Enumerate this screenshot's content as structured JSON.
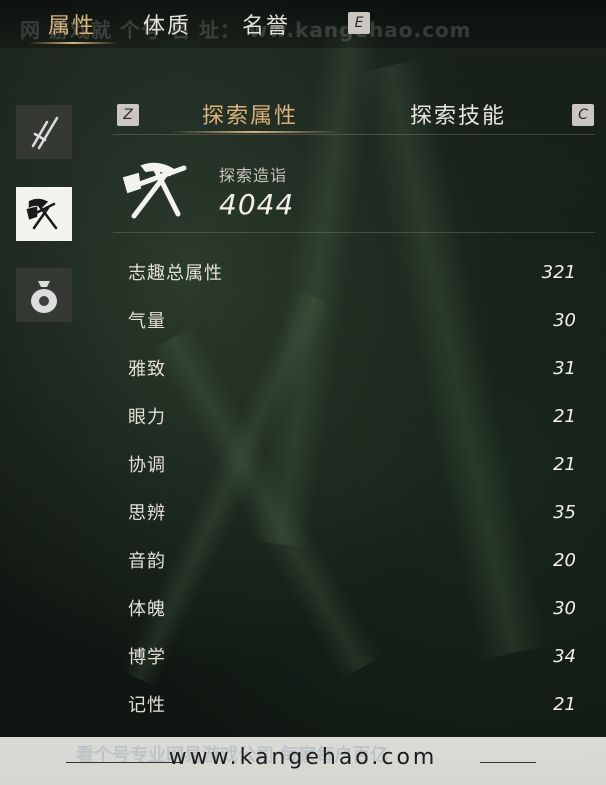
{
  "watermark": {
    "top": "网 游戏就 个号 名 址： ww.kangehao.com",
    "footer_url": "www.kangehao.com",
    "footer_ghost": "看个号专业网易游戏公司 每家每户百亿"
  },
  "top_tabs": [
    {
      "label": "属性",
      "active": true
    },
    {
      "label": "体质",
      "active": false
    },
    {
      "label": "名誉",
      "active": false
    }
  ],
  "top_key_hint": "E",
  "sidebar": {
    "items": [
      {
        "icon": "sword-icon",
        "active": false
      },
      {
        "icon": "pickaxe-shovel-icon",
        "active": true
      },
      {
        "icon": "money-bag-icon",
        "active": false
      }
    ]
  },
  "sub_tabs": {
    "left_key": "Z",
    "right_key": "C",
    "tabs": [
      {
        "label": "探索属性",
        "active": true
      },
      {
        "label": "探索技能",
        "active": false
      }
    ]
  },
  "summary": {
    "icon": "pickaxe-shovel-icon",
    "label": "探索造诣",
    "value": "4044"
  },
  "stats": [
    {
      "name": "志趣总属性",
      "value": "321"
    },
    {
      "name": "气量",
      "value": "30"
    },
    {
      "name": "雅致",
      "value": "31"
    },
    {
      "name": "眼力",
      "value": "21"
    },
    {
      "name": "协调",
      "value": "21"
    },
    {
      "name": "思辨",
      "value": "35"
    },
    {
      "name": "音韵",
      "value": "20"
    },
    {
      "name": "体魄",
      "value": "30"
    },
    {
      "name": "博学",
      "value": "34"
    },
    {
      "name": "记性",
      "value": "21"
    }
  ],
  "colors": {
    "accent": "#d9b27a",
    "text": "#e8e6df",
    "background": "#121914"
  }
}
